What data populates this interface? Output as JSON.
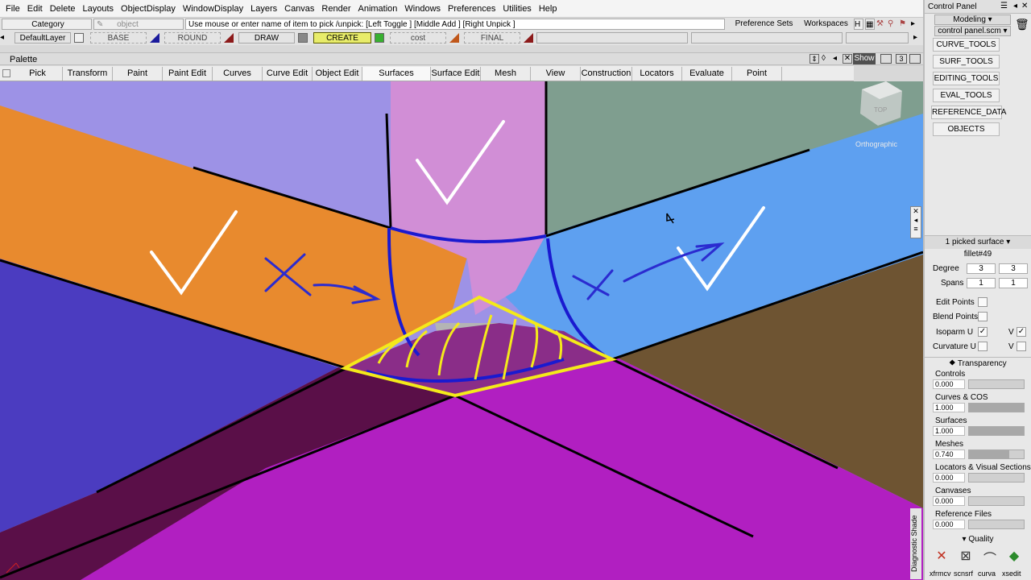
{
  "menu": [
    "File",
    "Edit",
    "Delete",
    "Layouts",
    "ObjectDisplay",
    "WindowDisplay",
    "Layers",
    "Canvas",
    "Render",
    "Animation",
    "Windows",
    "Preferences",
    "Utilities",
    "Help"
  ],
  "toolbar": {
    "category_label": "Category",
    "object_label": "object",
    "prompt": "Use mouse or enter name of item to pick /unpick: [Left Toggle ] [Middle Add ] [Right Unpick ]",
    "preference_sets": "Preference Sets",
    "workspaces": "Workspaces",
    "default_layer": "DefaultLayer",
    "layers": [
      "BASE",
      "ROUND",
      "DRAW",
      "CREATE",
      "cost",
      "FINAL"
    ]
  },
  "palette": {
    "title": "Palette",
    "show_label": "Show",
    "count_label": "3",
    "tabs": [
      "Pick",
      "Transform",
      "Paint",
      "Paint Edit",
      "Curves",
      "Curve Edit",
      "Object Edit",
      "Surfaces",
      "Surface Edit",
      "Mesh",
      "View",
      "Construction",
      "Locators",
      "Evaluate",
      "Point Clouds"
    ]
  },
  "viewport": {
    "camera_label": "Orthographic",
    "view_cube_label": "TOP",
    "diagnostic_label": "Diagnostic Shade"
  },
  "control_panel": {
    "title": "Control Panel",
    "mode": "Modeling",
    "file": "control panel.scm",
    "shelves": [
      "CURVE_TOOLS",
      "SURF_TOOLS",
      "EDITING_TOOLS",
      "EVAL_TOOLS",
      "REFERENCE_DATA",
      "OBJECTS"
    ],
    "picked": "1 picked surface",
    "object_name": "fillet#49",
    "degree_label": "Degree",
    "degree_u": "3",
    "degree_v": "3",
    "spans_label": "Spans",
    "spans_u": "1",
    "spans_v": "1",
    "edit_points": "Edit Points",
    "blend_points": "Blend Points",
    "isoparm_u": "Isoparm U",
    "curvature_u": "Curvature U",
    "v_label": "V",
    "transparency_title": "Transparency",
    "transparency": [
      {
        "label": "Controls",
        "value": "0.000",
        "level": 0.0
      },
      {
        "label": "Curves & COS",
        "value": "1.000",
        "level": 1.0
      },
      {
        "label": "Surfaces",
        "value": "1.000",
        "level": 1.0
      },
      {
        "label": "Meshes",
        "value": "0.740",
        "level": 0.74
      },
      {
        "label": "Locators & Visual Sections",
        "value": "0.000",
        "level": 0.0
      },
      {
        "label": "Canvases",
        "value": "0.000",
        "level": 0.0
      },
      {
        "label": "Reference Files",
        "value": "0.000",
        "level": 0.0
      }
    ],
    "quality_title": "Quality",
    "bottom_icons": [
      "xfrmcv",
      "scnsrf",
      "curva",
      "xsedit"
    ]
  },
  "colors": {
    "bg_purple": "#9d92e6",
    "orange": "#e88a2e",
    "blue": "#5ea0f0",
    "pink": "#d18ed6",
    "green": "#7f9e8f",
    "brown": "#6e5432",
    "magenta": "#b11fc1",
    "dark_plum": "#5a0f48",
    "indigo": "#4b3cc0",
    "fillet_yellow": "#f4ea1a",
    "curve_blue": "#1a1ad0"
  }
}
